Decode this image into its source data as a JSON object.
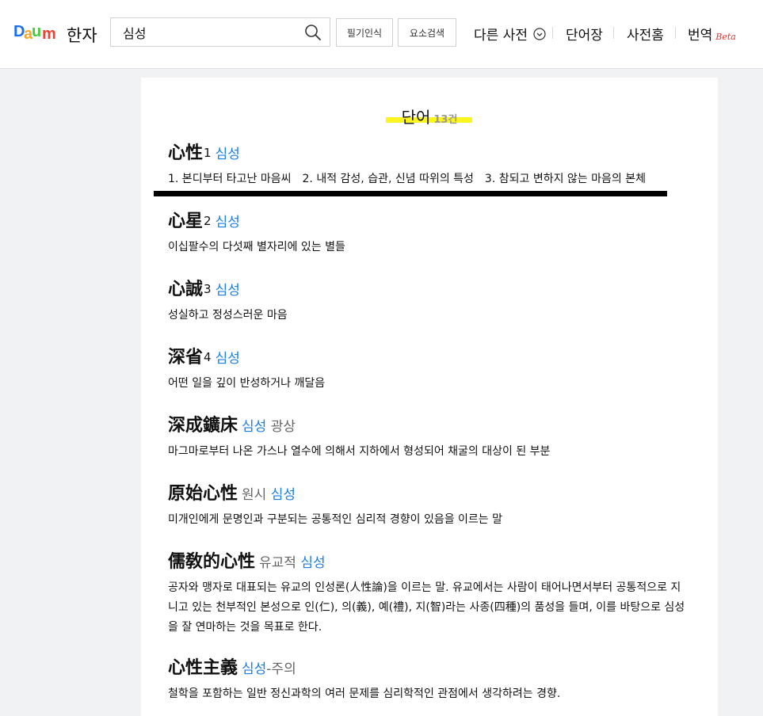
{
  "header": {
    "logo_letters": [
      "D",
      "a",
      "u",
      "m"
    ],
    "logo_colors": [
      "#1c6ef0",
      "#f5a623",
      "#47c83e",
      "#ea4335"
    ],
    "service_name": "한자",
    "search": {
      "value": "심성",
      "icon": "search-icon"
    },
    "buttons": {
      "handwriting": "필기인식",
      "component_search": "요소검색"
    },
    "nav": {
      "other_dict": "다른 사전",
      "wordbook": "단어장",
      "dict_home": "사전홈",
      "translate": "번역",
      "beta": "Beta"
    }
  },
  "section": {
    "title": "단어",
    "count": "13건"
  },
  "entries": [
    {
      "hanja": "心性",
      "num": "1",
      "reading": [
        {
          "t": "심성",
          "hl": true
        }
      ],
      "desc": [
        "1. 본디부터 타고난 마음씨",
        "2. 내적 감성, 습관, 신념 따위의 특성",
        "3. 참되고 변하지 않는 마음의 본체"
      ]
    },
    {
      "hanja": "心星",
      "num": "2",
      "reading": [
        {
          "t": "심성",
          "hl": true
        }
      ],
      "desc": [
        "이십팔수의 다섯째 별자리에 있는 별들"
      ]
    },
    {
      "hanja": "心誠",
      "num": "3",
      "reading": [
        {
          "t": "심성",
          "hl": true
        }
      ],
      "desc": [
        "성실하고 정성스러운 마음"
      ]
    },
    {
      "hanja": "深省",
      "num": "4",
      "reading": [
        {
          "t": "심성",
          "hl": true
        }
      ],
      "desc": [
        "어떤 일을 깊이 반성하거나 깨달음"
      ]
    },
    {
      "hanja": "深成鑛床",
      "num": "",
      "reading": [
        {
          "t": "심성",
          "hl": true
        },
        {
          "t": " 광상",
          "hl": false
        }
      ],
      "desc": [
        "마그마로부터 나온 가스나 열수에 의해서 지하에서 형성되어 채굴의 대상이 된 부분"
      ]
    },
    {
      "hanja": "原始心性",
      "num": "",
      "reading": [
        {
          "t": "원시 ",
          "hl": false
        },
        {
          "t": "심성",
          "hl": true
        }
      ],
      "desc": [
        "미개인에게 문명인과 구분되는 공통적인 심리적 경향이 있음을 이르는 말"
      ]
    },
    {
      "hanja": "儒敎的心性",
      "num": "",
      "reading": [
        {
          "t": "유교적 ",
          "hl": false
        },
        {
          "t": "심성",
          "hl": true
        }
      ],
      "desc": [
        "공자와 맹자로 대표되는 유교의 인성론(人性論)을 이르는 말. 유교에서는 사람이 태어나면서부터 공통적으로 지니고 있는 천부적인 본성으로 인(仁), 의(義), 예(禮), 지(智)라는 사종(四種)의 품성을 들며, 이를 바탕으로 심성을 잘 연마하는 것을 목표로 한다."
      ]
    },
    {
      "hanja": "心性主義",
      "num": "",
      "reading": [
        {
          "t": "심성",
          "hl": true
        },
        {
          "t": "-주의",
          "hl": false
        }
      ],
      "desc": [
        "철학을 포함하는 일반 정신과학의 여러 문제를 심리학적인 관점에서 생각하려는 경향."
      ]
    }
  ]
}
